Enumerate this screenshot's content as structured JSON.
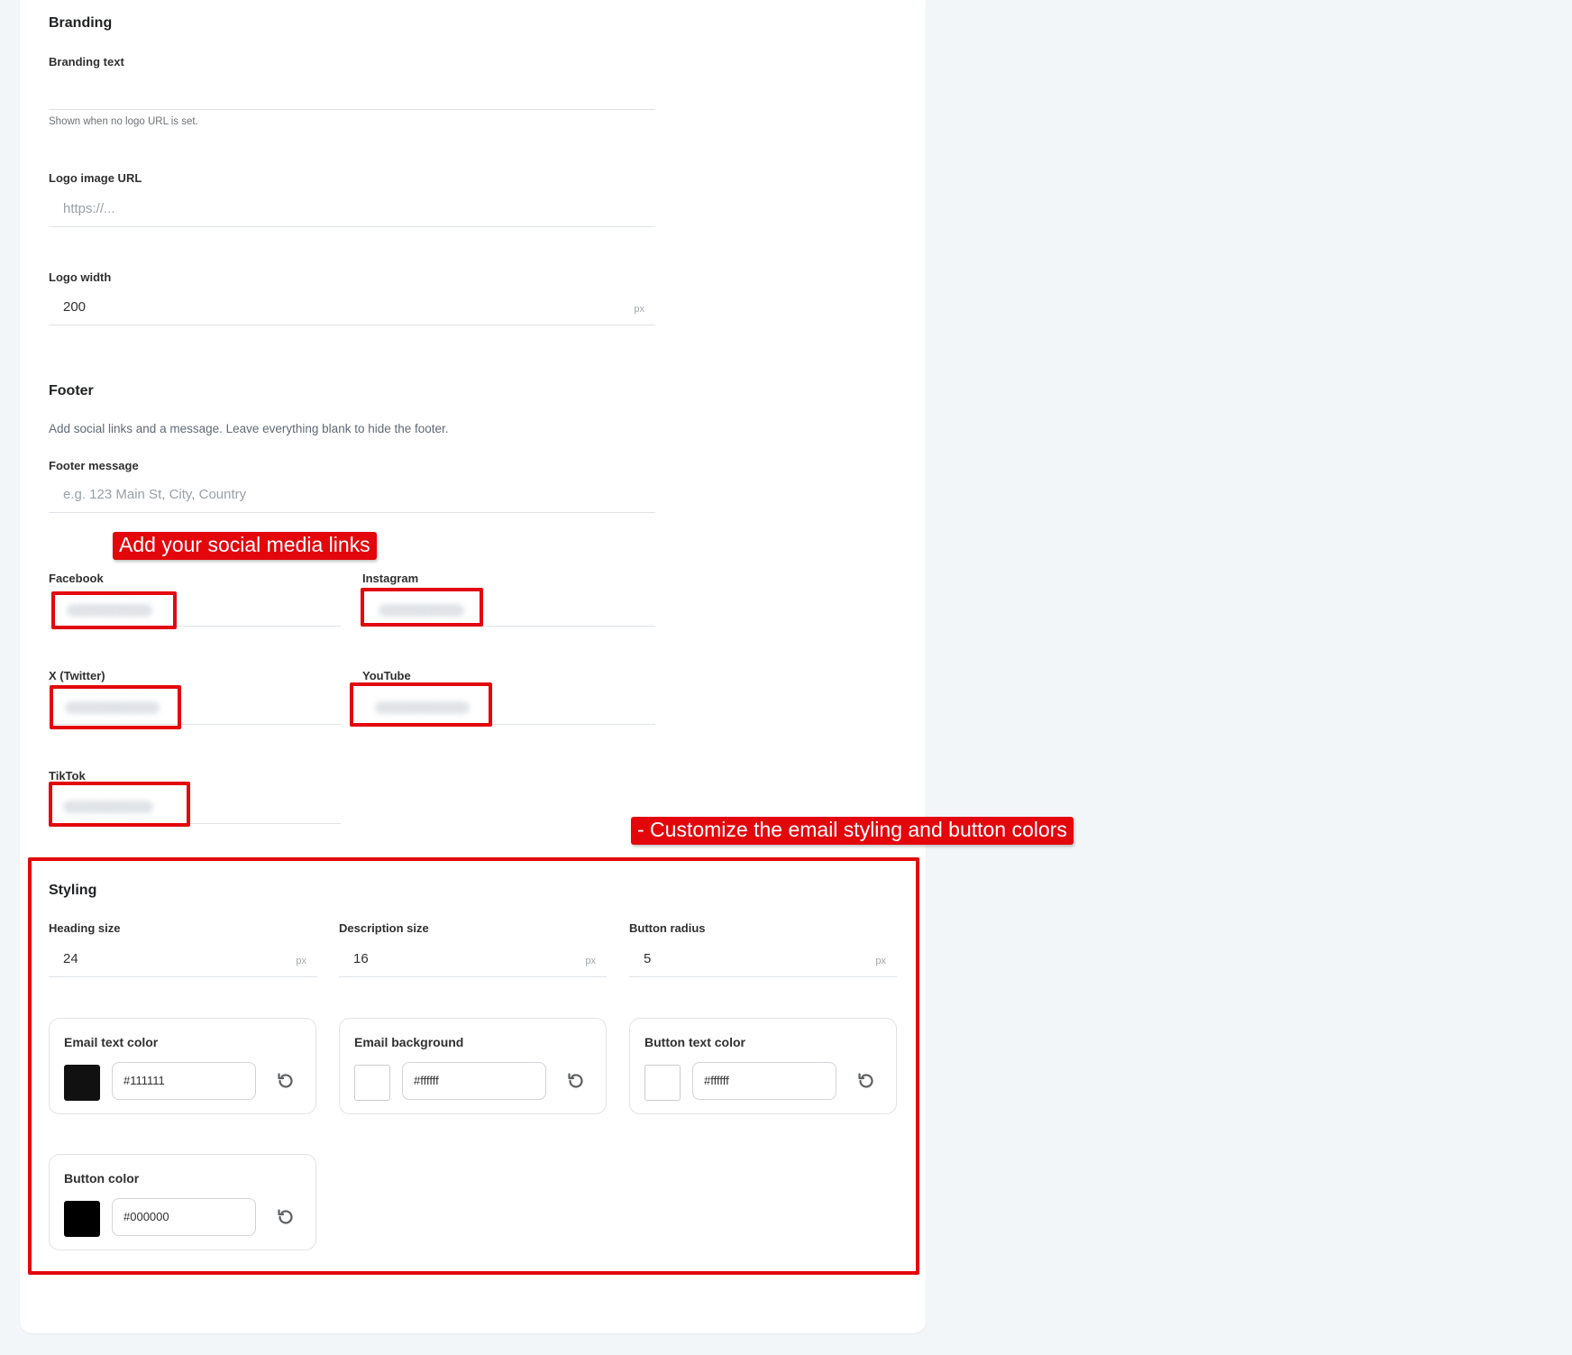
{
  "branding": {
    "title": "Branding",
    "branding_text": {
      "label": "Branding text",
      "value": "",
      "help": "Shown when no logo URL is set."
    },
    "logo_url": {
      "label": "Logo image URL",
      "placeholder": "https://..."
    },
    "logo_width": {
      "label": "Logo width",
      "value": "200",
      "suffix": "px"
    }
  },
  "footer": {
    "title": "Footer",
    "description": "Add social links and a message. Leave everything blank to hide the footer.",
    "message": {
      "label": "Footer message",
      "placeholder": "e.g. 123 Main St, City, Country"
    },
    "social": {
      "facebook": {
        "label": "Facebook"
      },
      "instagram": {
        "label": "Instagram"
      },
      "twitter": {
        "label": "X (Twitter)"
      },
      "youtube": {
        "label": "YouTube"
      },
      "tiktok": {
        "label": "TikTok"
      }
    }
  },
  "styling": {
    "title": "Styling",
    "heading_size": {
      "label": "Heading size",
      "value": "24",
      "suffix": "px"
    },
    "description_size": {
      "label": "Description size",
      "value": "16",
      "suffix": "px"
    },
    "button_radius": {
      "label": "Button radius",
      "value": "5",
      "suffix": "px"
    },
    "colors": {
      "email_text": {
        "label": "Email text color",
        "value": "#111111"
      },
      "email_background": {
        "label": "Email background",
        "value": "#ffffff"
      },
      "button_text": {
        "label": "Button text color",
        "value": "#ffffff"
      },
      "button": {
        "label": "Button color",
        "value": "#000000"
      }
    }
  },
  "annotations": {
    "social_callout": "Add your social media links",
    "styling_callout": "- Customize the email styling and button colors",
    "highlight_color": "#e3070b"
  },
  "icons": {
    "reset": "reset-icon"
  }
}
